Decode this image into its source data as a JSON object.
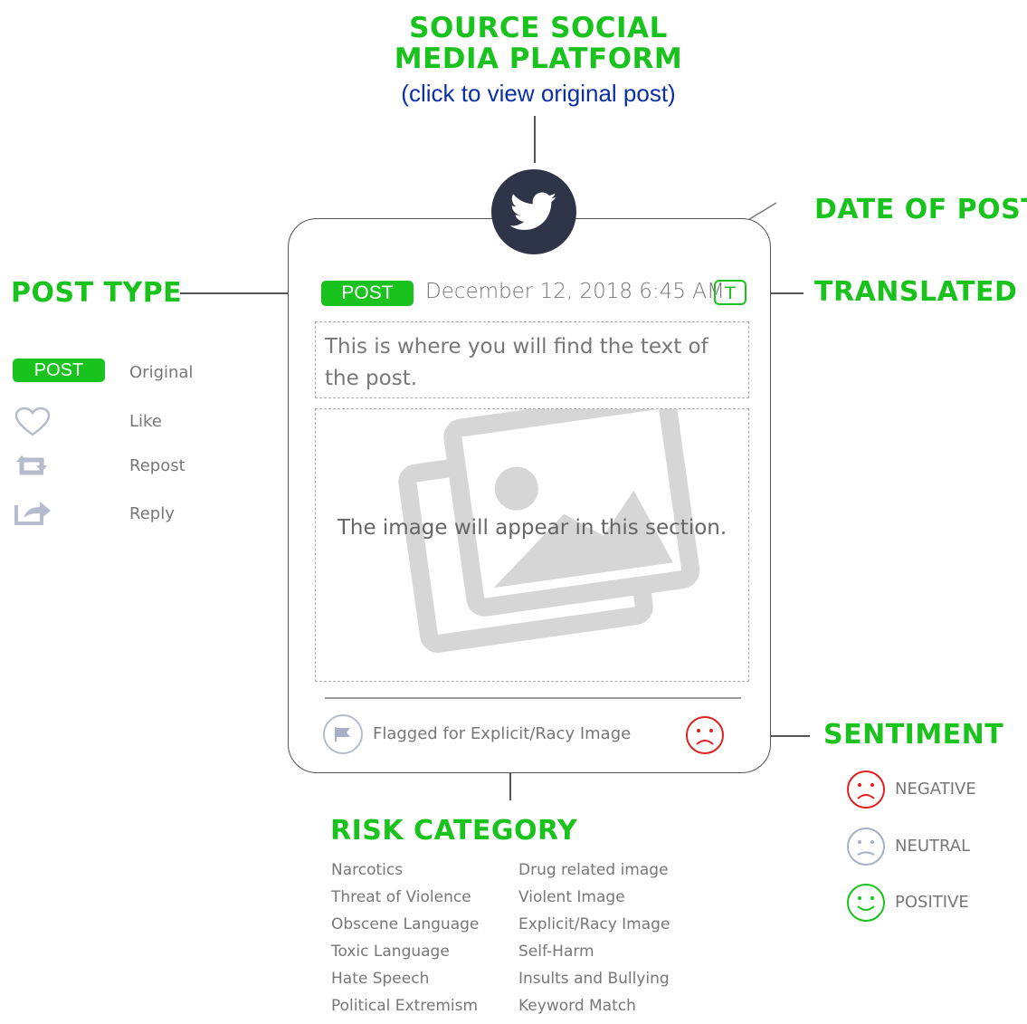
{
  "header": {
    "title_line1": "SOURCE SOCIAL",
    "title_line2": "MEDIA PLATFORM",
    "subtitle": "(click to view original post)"
  },
  "post": {
    "type_badge": "POST",
    "date": "December 12, 2018 6:45 AM",
    "translated_badge": "T",
    "text": "This is where you will find the text of the post.",
    "image_caption": "The image will appear in this section.",
    "flag_label": "Flagged for Explicit/Racy Image"
  },
  "labels": {
    "date_of_post": "DATE OF POST",
    "translated": "TRANSLATED",
    "post_type": "POST TYPE",
    "sentiment": "SENTIMENT",
    "risk_category": "RISK CATEGORY"
  },
  "post_type_legend": [
    {
      "icon": "post-badge",
      "badge": "POST",
      "label": "Original"
    },
    {
      "icon": "heart-icon",
      "label": "Like"
    },
    {
      "icon": "repost-icon",
      "label": "Repost"
    },
    {
      "icon": "reply-icon",
      "label": "Reply"
    }
  ],
  "sentiment_legend": [
    {
      "icon": "frown-face-icon",
      "color": "#e02020",
      "label": "NEGATIVE"
    },
    {
      "icon": "neutral-face-icon",
      "color": "#a9b0c6",
      "label": "NEUTRAL"
    },
    {
      "icon": "smile-face-icon",
      "color": "#19c21c",
      "label": "POSITIVE"
    }
  ],
  "risk_categories": {
    "column1": [
      "Narcotics",
      "Threat of Violence",
      "Obscene Language",
      "Toxic Language",
      "Hate Speech",
      "Political Extremism"
    ],
    "column2": [
      "Drug related image",
      "Violent Image",
      "Explicit/Racy Image",
      "Self-Harm",
      "Insults and Bullying",
      "Keyword Match"
    ]
  },
  "colors": {
    "accent_green": "#19c21c",
    "link_blue": "#0b2fa8",
    "negative_red": "#e02020",
    "logo_dark": "#2f3548",
    "icon_gray": "#b6bccd"
  }
}
